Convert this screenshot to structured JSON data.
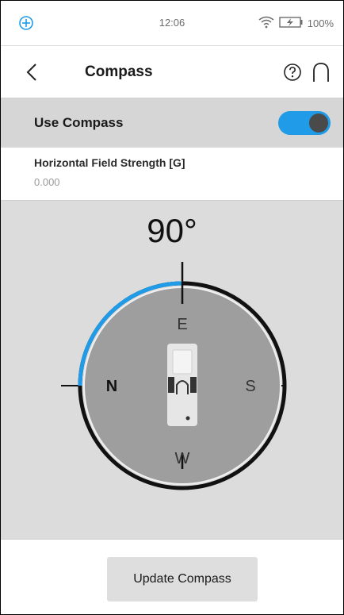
{
  "status_bar": {
    "time": "12:06",
    "battery": "100%",
    "icons": [
      "gps-icon",
      "wifi-icon",
      "battery-icon"
    ]
  },
  "header": {
    "title": "Compass",
    "icons": [
      "back-chevron-icon",
      "help-icon",
      "home-icon"
    ]
  },
  "use_compass": {
    "label": "Use Compass",
    "enabled": true
  },
  "field_strength": {
    "label": "Horizontal Field Strength [G]",
    "value": "0.000"
  },
  "compass": {
    "heading": "90°",
    "cardinals": {
      "north": "N",
      "east": "E",
      "south": "S",
      "west": "W"
    },
    "arc_color": "#1f9be8"
  },
  "actions": {
    "update_label": "Update Compass"
  },
  "colors": {
    "accent": "#1f9be8",
    "panel_gray": "#dcdcdc",
    "dial_gray": "#9e9e9e"
  }
}
